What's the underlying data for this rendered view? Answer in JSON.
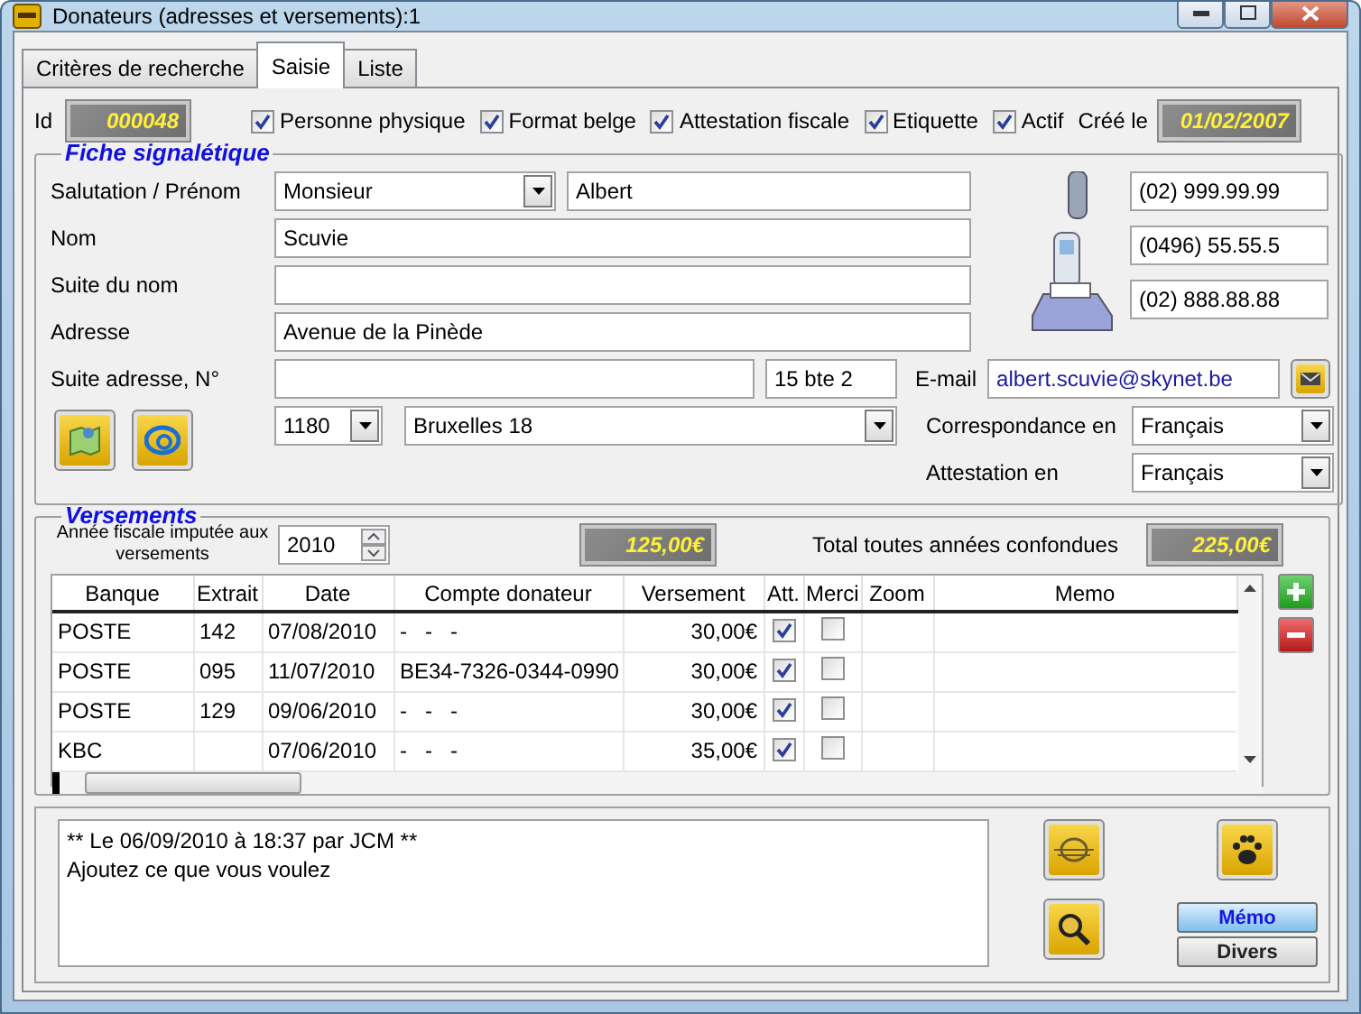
{
  "window": {
    "title": "Donateurs (adresses et versements):1"
  },
  "tabs": [
    {
      "label": "Critères de recherche",
      "selected": false
    },
    {
      "label": "Saisie",
      "selected": true
    },
    {
      "label": "Liste",
      "selected": false
    }
  ],
  "header": {
    "id_label": "Id",
    "id_value": "000048",
    "options": [
      {
        "label": "Personne physique",
        "checked": true
      },
      {
        "label": "Format belge",
        "checked": true
      },
      {
        "label": "Attestation fiscale",
        "checked": true
      },
      {
        "label": "Etiquette",
        "checked": true
      },
      {
        "label": "Actif",
        "checked": true
      }
    ],
    "created_label": "Créé le",
    "created_value": "01/02/2007"
  },
  "fiche": {
    "title": "Fiche signalétique",
    "salutation_label": "Salutation / Prénom",
    "salutation": "Monsieur",
    "prenom": "Albert",
    "nom_label": "Nom",
    "nom": "Scuvie",
    "suite_nom_label": "Suite du nom",
    "adresse_label": "Adresse",
    "adresse": "Avenue de la Pinède",
    "suite_adresse_label": "Suite adresse, N°",
    "numero": "15 bte 2",
    "phone": "(02) 999.99.99",
    "mobile": "(0496) 55.55.5",
    "fax": "(02) 888.88.88",
    "email_label": "E-mail",
    "email": "albert.scuvie@skynet.be",
    "postcode": "1180",
    "city": "Bruxelles 18",
    "correspondance_label": "Correspondance en",
    "correspondance": "Français",
    "attestation_label": "Attestation en",
    "attestation": "Français"
  },
  "versements": {
    "title": "Versements",
    "year_label": "Année fiscale imputée aux versements",
    "year": "2010",
    "year_total": "125,00€",
    "total_label": "Total toutes années confondues",
    "total": "225,00€",
    "columns": [
      "Banque",
      "Extrait",
      "Date",
      "Compte donateur",
      "Versement",
      "Att.",
      "Merci",
      "Zoom",
      "Memo"
    ],
    "rows": [
      {
        "banque": "POSTE",
        "extrait": "142",
        "date": "07/08/2010",
        "compte": "-   -   -",
        "versement": "30,00€",
        "att": true,
        "merci": false
      },
      {
        "banque": "POSTE",
        "extrait": "095",
        "date": "11/07/2010",
        "compte": "BE34-7326-0344-0990",
        "versement": "30,00€",
        "att": true,
        "merci": false
      },
      {
        "banque": "POSTE",
        "extrait": "129",
        "date": "09/06/2010",
        "compte": "-   -   -",
        "versement": "30,00€",
        "att": true,
        "merci": false
      },
      {
        "banque": "KBC",
        "extrait": "",
        "date": "07/06/2010",
        "compte": "-   -   -",
        "versement": "35,00€",
        "att": true,
        "merci": false
      }
    ]
  },
  "memo": {
    "lines": [
      "** Le 06/09/2010 à 18:37 par JCM **",
      "Ajoutez ce que vous voulez"
    ],
    "tabs": [
      {
        "label": "Mémo",
        "selected": true
      },
      {
        "label": "Divers",
        "selected": false
      }
    ]
  }
}
